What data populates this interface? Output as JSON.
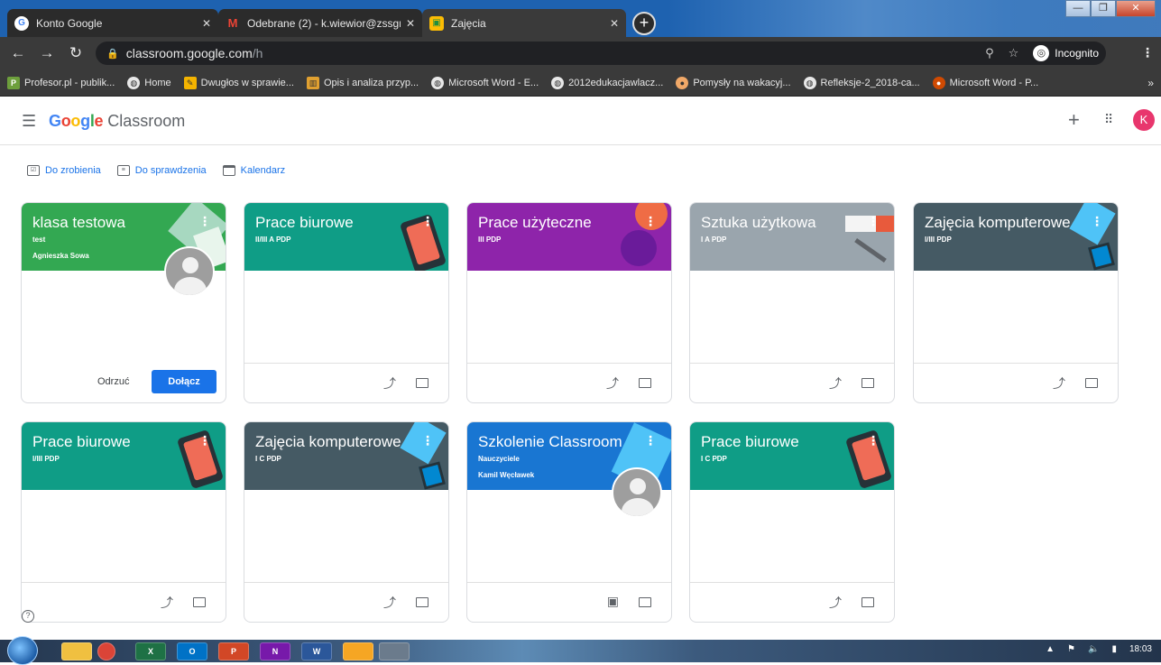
{
  "browser": {
    "tabs": [
      {
        "title": "Konto Google",
        "favicon": "google-icon",
        "active": false
      },
      {
        "title": "Odebrane (2) - k.wiewior@zssgro",
        "favicon": "gmail-icon",
        "active": false
      },
      {
        "title": "Zajęcia",
        "favicon": "classroom-icon",
        "active": true
      }
    ],
    "new_tab": "+",
    "url_host": "classroom.google.com",
    "url_path": "/h",
    "incognito_label": "Incognito",
    "bookmarks": [
      {
        "label": "Profesor.pl - publik...",
        "icon": "profesor-icon"
      },
      {
        "label": "Home",
        "icon": "globe-icon"
      },
      {
        "label": "Dwugłos w sprawie...",
        "icon": "site-icon"
      },
      {
        "label": "Opis i analiza przyp...",
        "icon": "site-icon"
      },
      {
        "label": "Microsoft Word - E...",
        "icon": "globe-icon"
      },
      {
        "label": "2012edukacjawlacz...",
        "icon": "globe-icon"
      },
      {
        "label": "Pomysły na wakacyj...",
        "icon": "site-icon"
      },
      {
        "label": "Refleksje-2_2018-ca...",
        "icon": "globe-icon"
      },
      {
        "label": "Microsoft Word - P...",
        "icon": "site-icon"
      }
    ]
  },
  "header": {
    "brand_google": "Google",
    "brand_product": "Classroom",
    "add_label": "+",
    "avatar_letter": "K"
  },
  "quick_links": [
    {
      "label": "Do zrobienia",
      "icon": "todo-icon"
    },
    {
      "label": "Do sprawdzenia",
      "icon": "review-icon"
    },
    {
      "label": "Kalendarz",
      "icon": "calendar-icon"
    }
  ],
  "invite_card": {
    "title": "klasa testowa",
    "section": "test",
    "teacher": "Agnieszka Sowa",
    "reject_label": "Odrzuć",
    "join_label": "Dołącz",
    "color": "#1e8e3e"
  },
  "classes": [
    {
      "title": "Prace biurowe",
      "section": "II/III A PDP",
      "color": "#129eaf"
    },
    {
      "title": "Prace użyteczne",
      "section": "III PDP",
      "color": "#8e24aa"
    },
    {
      "title": "Sztuka użytkowa",
      "section": "I A PDP",
      "color": "#9aa5ad"
    },
    {
      "title": "Zajęcia komputerowe",
      "section": "I/III PDP",
      "color": "#455a64"
    },
    {
      "title": "Prace biurowe",
      "section": "I/III PDP",
      "color": "#129eaf"
    },
    {
      "title": "Zajęcia komputerowe",
      "section": "I C PDP",
      "color": "#455a64"
    },
    {
      "title": "Szkolenie Classroom",
      "section": "Nauczyciele",
      "teacher": "Kamil Węcławek",
      "color": "#1a73e8"
    },
    {
      "title": "Prace biurowe",
      "section": "I C PDP",
      "color": "#129eaf"
    }
  ],
  "taskbar": {
    "apps": [
      "explorer-icon",
      "chrome-icon",
      "excel-icon",
      "outlook-icon",
      "powerpoint-icon",
      "onenote-icon",
      "word-icon",
      "paint-icon",
      "app-icon"
    ],
    "app_labels": [
      "",
      "",
      "X",
      "O",
      "P",
      "N",
      "W",
      "",
      ""
    ],
    "clock": "18:03"
  }
}
